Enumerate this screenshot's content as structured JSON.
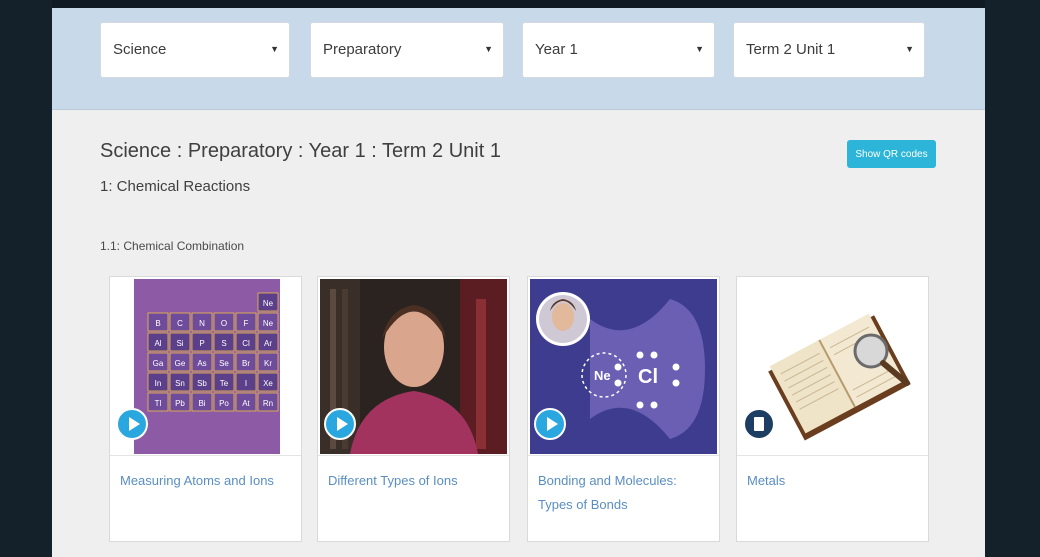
{
  "filters": [
    {
      "value": "Science"
    },
    {
      "value": "Preparatory"
    },
    {
      "value": "Year 1"
    },
    {
      "value": "Term 2 Unit 1"
    }
  ],
  "header": {
    "breadcrumb": "Science : Preparatory : Year 1 : Term 2 Unit 1",
    "subtitle": "1: Chemical Reactions",
    "qr_button": "Show QR codes"
  },
  "section": {
    "title": "1.1: Chemical Combination",
    "cards": [
      {
        "title": "Measuring Atoms and Ions",
        "type": "video",
        "icon": "play-icon"
      },
      {
        "title": "Different Types of Ions",
        "type": "video",
        "icon": "play-icon"
      },
      {
        "title": "Bonding and Molecules: Types of Bonds",
        "type": "video",
        "icon": "play-icon"
      },
      {
        "title": "Metals",
        "type": "document",
        "icon": "document-icon"
      }
    ]
  },
  "thumbnails": {
    "periodic_table": {
      "cells": [
        [
          "",
          "",
          "",
          "",
          "",
          "Ne"
        ],
        [
          "B",
          "C",
          "N",
          "O",
          "F",
          "Ne"
        ],
        [
          "Al",
          "Si",
          "P",
          "S",
          "Cl",
          "Ar"
        ],
        [
          "Ga",
          "Ge",
          "As",
          "Se",
          "Br",
          "Kr"
        ],
        [
          "In",
          "Sn",
          "Sb",
          "Te",
          "I",
          "Xe"
        ],
        [
          "Tl",
          "Pb",
          "Bi",
          "Po",
          "At",
          "Rn"
        ]
      ]
    },
    "bonding": {
      "ion_left": "Ne",
      "ion_right": "Cl"
    }
  },
  "colors": {
    "accent": "#2cb5d8",
    "link": "#5a8ec2",
    "top_band": "#c8d9ea",
    "frame": "#14202a"
  }
}
